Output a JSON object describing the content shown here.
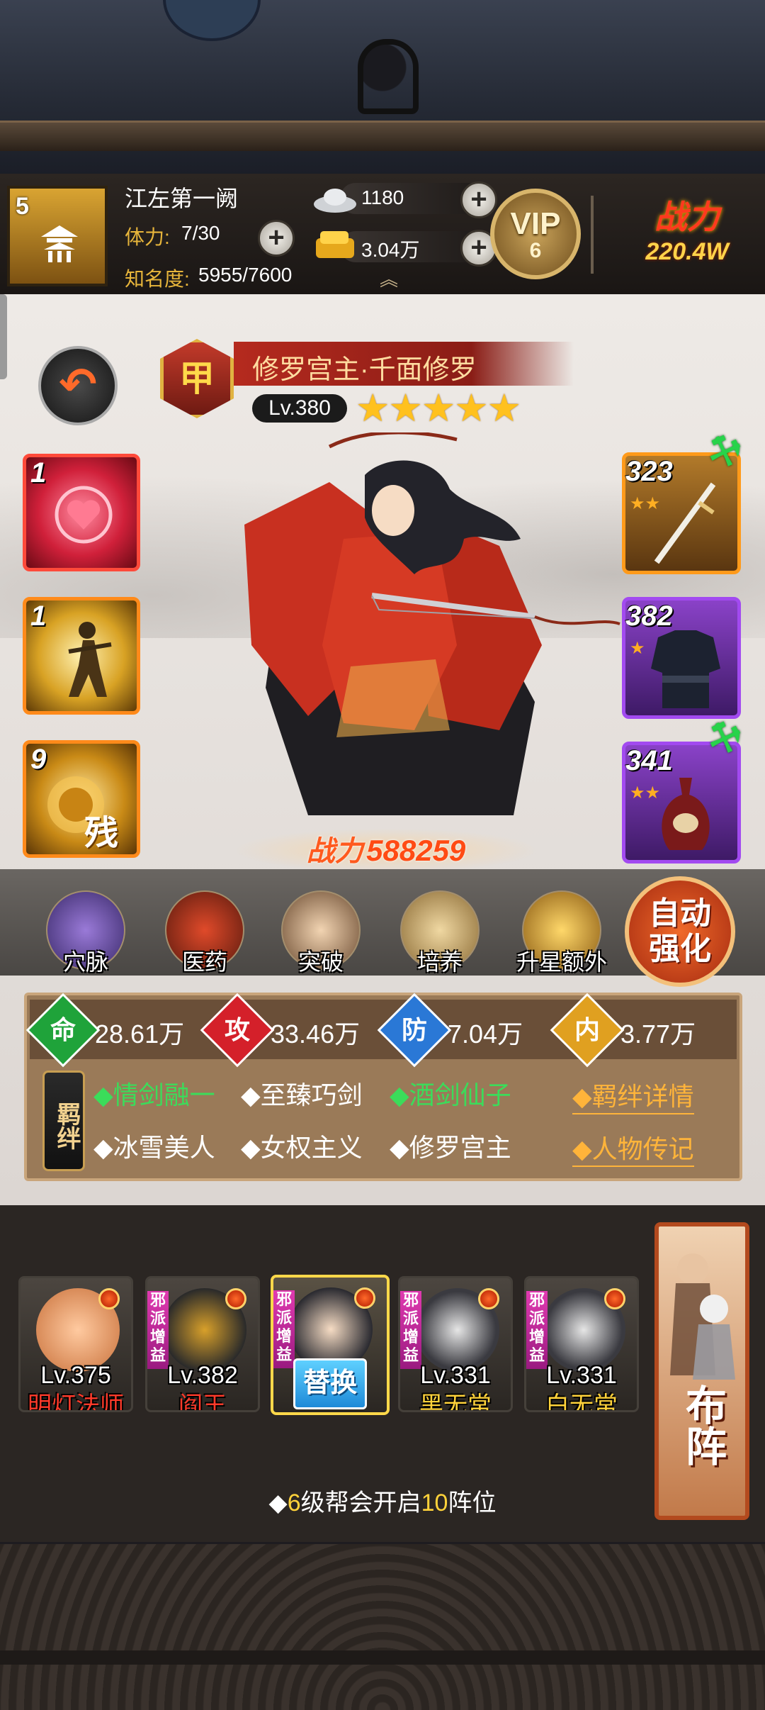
{
  "player": {
    "level": "5",
    "name": "江左第一阙",
    "stamina_label": "体力:",
    "stamina_value": "7/30",
    "fame_label": "知名度:",
    "fame_value": "5955/7600"
  },
  "resources": {
    "silver": "1180",
    "gold": "3.04万"
  },
  "vip": {
    "label": "VIP",
    "level": "6"
  },
  "power": {
    "label": "战力",
    "value": "220.4W"
  },
  "hero": {
    "grade": "甲",
    "name": "修罗宫主·千面修罗",
    "level": "Lv.380",
    "stars": "★★★★★",
    "combat_label": "战力",
    "combat_value": "588259"
  },
  "skills": [
    {
      "num": "1"
    },
    {
      "num": "1"
    },
    {
      "num": "9",
      "char": "残"
    }
  ],
  "equipment": [
    {
      "num": "323",
      "stars": "★★"
    },
    {
      "num": "382",
      "stars": "★"
    },
    {
      "num": "341",
      "stars": "★★"
    }
  ],
  "functions": [
    "穴脉",
    "医药",
    "突破",
    "培养",
    "升星额外"
  ],
  "auto_enhance": {
    "line1": "自动",
    "line2": "强化"
  },
  "attributes": [
    {
      "icon": "命",
      "value": "28.61万",
      "color": "#1fa33a"
    },
    {
      "icon": "攻",
      "value": "33.46万",
      "color": "#d4202a"
    },
    {
      "icon": "防",
      "value": "7.04万",
      "color": "#2a78d6"
    },
    {
      "icon": "内",
      "value": "3.77万",
      "color": "#e0a020"
    }
  ],
  "bonds": {
    "tag": "羁绊",
    "row1": [
      "◆情剑融一",
      "◆至臻巧剑",
      "◆酒剑仙子"
    ],
    "row2": [
      "◆冰雪美人",
      "◆女权主义",
      "◆修罗宫主"
    ],
    "link1": "◆羁绊详情",
    "link2": "◆人物传记"
  },
  "team": [
    {
      "level": "Lv.375",
      "name": "明灯法师",
      "name_color": "#ff3a2a",
      "badge": ""
    },
    {
      "level": "Lv.382",
      "name": "阎王",
      "name_color": "#ff3a2a",
      "badge": "邪派增益"
    },
    {
      "level": "",
      "name": "",
      "name_color": "#ffffff",
      "badge": "邪派增益",
      "action": "替换"
    },
    {
      "level": "Lv.331",
      "name": "黑无常",
      "name_color": "#ffd23a",
      "badge": "邪派增益"
    },
    {
      "level": "Lv.331",
      "name": "白无常",
      "name_color": "#ffd23a",
      "badge": "邪派增益"
    }
  ],
  "formation_label": "布阵",
  "note": {
    "prefix": "◆",
    "num1": "6",
    "mid": "级帮会开启",
    "num2": "10",
    "suffix": "阵位"
  }
}
